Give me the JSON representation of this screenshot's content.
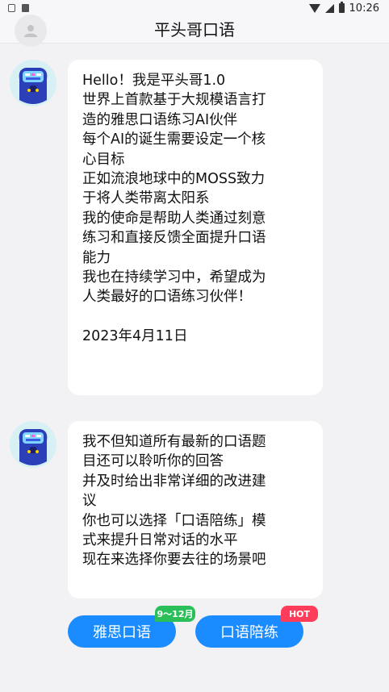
{
  "statusbar": {
    "time": "10:26"
  },
  "header": {
    "title": "平头哥口语"
  },
  "messages": [
    {
      "lines": [
        "Hello！我是平头哥1.0",
        "世界上首款基于大规模语言打",
        "造的雅思口语练习AI伙伴",
        "每个AI的诞生需要设定一个核",
        "心目标",
        "正如流浪地球中的MOSS致力",
        "于将人类带离太阳系",
        "我的使命是帮助人类通过刻意",
        "练习和直接反馈全面提升口语",
        "能力",
        "我也在持续学习中，希望成为",
        "人类最好的口语练习伙伴！",
        "",
        "2023年4月11日"
      ]
    },
    {
      "lines": [
        "我不但知道所有最新的口语题",
        "目还可以聆听你的回答",
        "并及时给出非常详细的改进建",
        "议",
        "你也可以选择「口语陪练」模",
        "式来提升日常对话的水平",
        "现在来选择你要去往的场景吧"
      ]
    }
  ],
  "buttons": [
    {
      "label": "雅思口语",
      "badge": "9～12月",
      "badge_color": "#2bbf5a"
    },
    {
      "label": "口语陪练",
      "badge": "HOT",
      "badge_color": "#ff3d5a"
    }
  ],
  "colors": {
    "accent": "#1a8cff",
    "background": "#f2f2f4"
  }
}
